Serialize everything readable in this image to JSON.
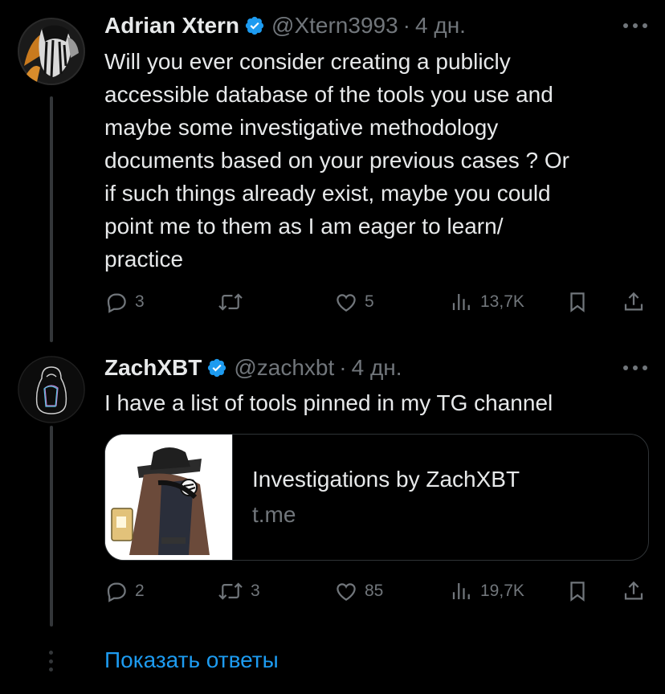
{
  "tweets": [
    {
      "author": {
        "name": "Adrian Xtern",
        "handle": "@Xtern3993",
        "verified": true
      },
      "time": "4 дн.",
      "text": "Will you ever consider creating a publicly\naccessible database of the tools you use and\nmaybe some investigative methodology\ndocuments based on your previous cases ? Or\nif such things already exist, maybe you could\npoint me to them as I am eager to learn/\npractice",
      "actions": {
        "replies": "3",
        "reposts": "",
        "likes": "5",
        "views": "13,7K"
      }
    },
    {
      "author": {
        "name": "ZachXBT",
        "handle": "@zachxbt",
        "verified": true
      },
      "time": "4 дн.",
      "text": "I have a list of tools pinned in my TG channel",
      "card": {
        "title": "Investigations by ZachXBT",
        "domain": "t.me"
      },
      "actions": {
        "replies": "2",
        "reposts": "3",
        "likes": "85",
        "views": "19,7K"
      }
    }
  ],
  "show_replies_label": "Показать ответы",
  "colors": {
    "background": "#000000",
    "text_primary": "#e7e9ea",
    "text_secondary": "#71767b",
    "accent": "#1d9bf0",
    "border": "#2f3336"
  },
  "icons": [
    "verified-badge-icon",
    "more-icon",
    "reply-icon",
    "repost-icon",
    "like-icon",
    "views-icon",
    "bookmark-icon",
    "share-icon"
  ]
}
